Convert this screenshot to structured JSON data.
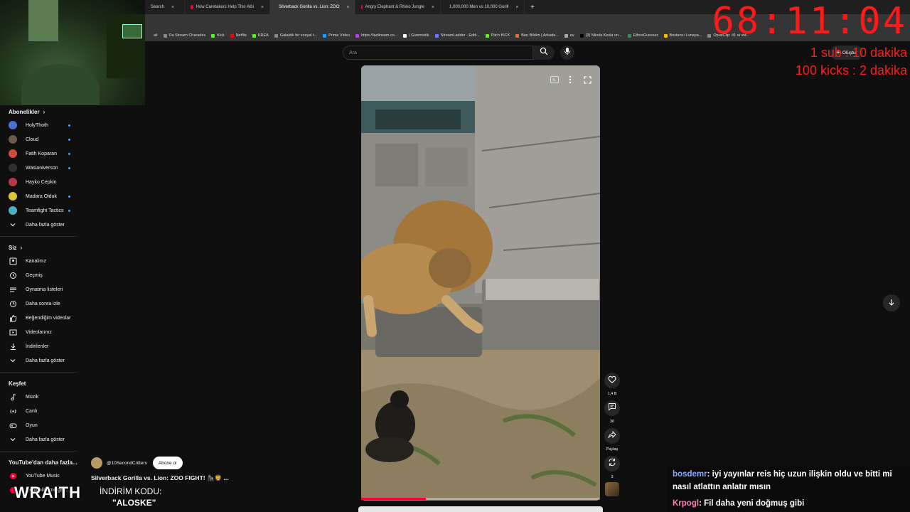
{
  "browser": {
    "tabs": [
      {
        "label": "Search",
        "active": false
      },
      {
        "label": "How Caretakers Help This Albi",
        "active": false
      },
      {
        "label": "Silverback Gorilla vs. Lion: ZOO",
        "active": true
      },
      {
        "label": "Angry Elephant & Rhino Jungle",
        "active": false
      },
      {
        "label": "1,000,000 Men vs 10,000 Gorill",
        "active": false
      }
    ],
    "close_glyph": "×",
    "new_tab_glyph": "+",
    "bookmarks": [
      "ail",
      "Da Stream Charades",
      "Kick",
      "Netflix",
      "KREA",
      "Galaktik bir sosyal t...",
      "Prime Video",
      "https://lazlinsam.co...",
      "| Gizemistik",
      "StreamLadder - Editi...",
      "Pitch KICK",
      "Ben Bildim | Arkada...",
      "ev",
      "(3) Nikola Kesla on...",
      "EthosGuesser",
      "Bostancı Lunapa...",
      "OpusClip: #1 ai vid..."
    ]
  },
  "overlay": {
    "timer": "68:11:04",
    "goal1": "1 sub : 10 dakika",
    "goal2": "100 kicks : 2 dakika",
    "brand": "WRAITH",
    "promo_line1": "İNDİRİM KODU:",
    "promo_line2": "\"ALOSKE\""
  },
  "header": {
    "search_placeholder": "Ara",
    "create_label": "Oluştur",
    "create_glyph": "+"
  },
  "sidebar": {
    "subscriptions_title": "Abonelikler",
    "subscriptions": [
      {
        "label": "HolyThoth",
        "color": "#4a6fd1",
        "live": true
      },
      {
        "label": "Cloud",
        "color": "#6b5b4b",
        "live": true
      },
      {
        "label": "Fatih Koparan",
        "color": "#d04a3a",
        "live": true
      },
      {
        "label": "Wasianiverson",
        "color": "#2f2f2f",
        "live": true
      },
      {
        "label": "Hayko Cepkin",
        "color": "#b23a48",
        "live": false
      },
      {
        "label": "Madara Olduk",
        "color": "#e0c23a",
        "live": true
      },
      {
        "label": "Teamfight Tactics",
        "color": "#4ab0c8",
        "live": true
      }
    ],
    "show_more": "Daha fazla göster",
    "you_title": "Siz",
    "you_items": [
      "Kanalınız",
      "Geçmiş",
      "Oynatma listeleri",
      "Daha sonra izle",
      "Beğendiğim videolar",
      "Videolarınız",
      "İndirilenler"
    ],
    "explore_title": "Keşfet",
    "explore_items": [
      "Müzik",
      "Canlı",
      "Oyun"
    ],
    "more_title": "YouTube'dan daha fazla...",
    "more_items": [
      "YouTube Music"
    ],
    "cut_item": "İçerik bildirme geç..."
  },
  "video": {
    "channel": "@10SecondCritters",
    "subscribe_label": "Abone ol",
    "title": "Silverback Gorilla vs. Lion: ZOO FIGHT! 🦍🦁 ...",
    "progress": 0.27
  },
  "actions": {
    "likes": "1,4 B",
    "comments": "30",
    "share": "Paylaş",
    "remix": "3"
  },
  "chat": [
    {
      "user": "bosdemr",
      "text": ": iyi yayınlar reis hiç uzun ilişkin oldu ve bitti mi",
      "cont": "nasıl atlattın anlatır mısın"
    },
    {
      "user": "Krpogl",
      "text": ": Fil daha yeni doğmuş gibi"
    }
  ],
  "colors": {
    "accent_red": "#ff0033",
    "overlay_red": "#ff1a1a",
    "live_blue": "#3ea6ff"
  }
}
